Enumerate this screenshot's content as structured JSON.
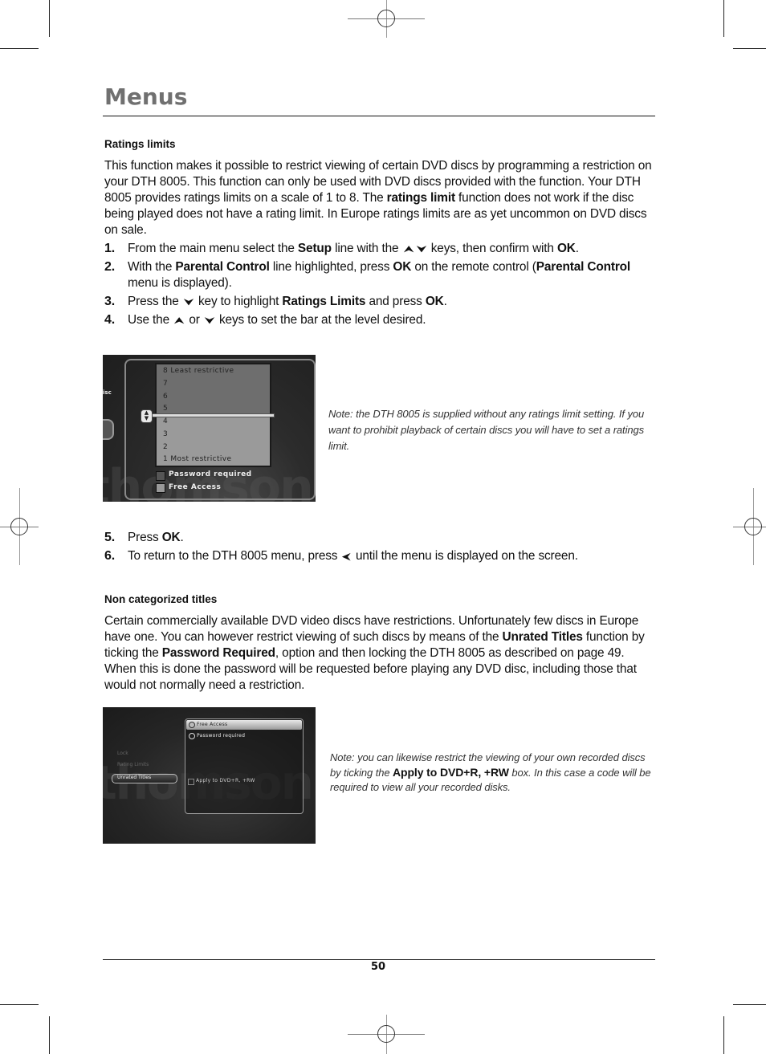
{
  "page": {
    "title": "Menus",
    "page_number": "50"
  },
  "ratings": {
    "heading": "Ratings limits",
    "intro": [
      {
        "t": "This function makes it possible to restrict viewing of certain DVD discs by programming a restriction on your DTH 8005. This function can only be used with DVD discs provided with the function. Your DTH 8005 provides ratings limits on a scale of 1 to 8. The "
      },
      {
        "b": "ratings limit"
      },
      {
        "t": " function does not work if the disc being played does not have a rating limit. In Europe ratings limits are as yet uncommon on DVD discs on sale."
      }
    ],
    "steps": [
      {
        "num": "1.",
        "parts": [
          {
            "t": "From the main menu select the "
          },
          {
            "b": "Setup"
          },
          {
            "t": " line with the "
          },
          {
            "k": "up-arrow"
          },
          {
            "k": "down-arrow"
          },
          {
            "t": " keys, then confirm with "
          },
          {
            "b": "OK"
          },
          {
            "t": "."
          }
        ]
      },
      {
        "num": "2.",
        "parts": [
          {
            "t": "With the "
          },
          {
            "b": "Parental Control"
          },
          {
            "t": " line highlighted, press "
          },
          {
            "b": "OK"
          },
          {
            "t": " on the remote control ("
          },
          {
            "b": "Parental Control"
          },
          {
            "t": " menu is displayed)."
          }
        ]
      },
      {
        "num": "3.",
        "parts": [
          {
            "t": "Press the "
          },
          {
            "k": "down-arrow"
          },
          {
            "t": " key to highlight "
          },
          {
            "b": "Ratings Limits"
          },
          {
            "t": " and press "
          },
          {
            "b": "OK"
          },
          {
            "t": "."
          }
        ]
      },
      {
        "num": "4.",
        "parts": [
          {
            "t": "Use the "
          },
          {
            "k": "up-arrow"
          },
          {
            "t": " or "
          },
          {
            "k": "down-arrow"
          },
          {
            "t": " keys to set the bar at the level desired."
          }
        ]
      }
    ],
    "screen": {
      "side_label": "isc",
      "levels": [
        "8 Least restrictive",
        "7",
        "6",
        "5",
        "4",
        "3",
        "2",
        "1 Most restrictive"
      ],
      "selected_level": 5,
      "checkboxes": [
        "Password required",
        "Free Access"
      ],
      "watermark": "thomson"
    },
    "note": "Note: the DTH 8005 is supplied without any ratings limit setting. If you want to prohibit playback of certain discs you will have to set a ratings limit.",
    "steps2": [
      {
        "num": "5.",
        "parts": [
          {
            "t": "Press "
          },
          {
            "b": "OK"
          },
          {
            "t": "."
          }
        ]
      },
      {
        "num": "6.",
        "parts": [
          {
            "t": "To return to the DTH 8005 menu, press "
          },
          {
            "k": "left-arrow"
          },
          {
            "t": " until the menu is displayed on the screen."
          }
        ]
      }
    ]
  },
  "unrated": {
    "heading": "Non categorized titles",
    "intro": [
      {
        "t": "Certain commercially available DVD video discs have restrictions. Unfortunately few discs in Europe have one. You can however restrict viewing of such discs by means of the "
      },
      {
        "b": "Unrated Titles"
      },
      {
        "t": " function by ticking the "
      },
      {
        "b": "Password Required"
      },
      {
        "t": ", option and then locking the DTH 8005 as described on page 49. When this is done the password will be requested before playing any DVD disc, including those that would not normally need a restriction."
      }
    ],
    "screen": {
      "menu_items": [
        "Lock",
        "Rating Limits",
        "Unrated Titles"
      ],
      "selected_menu": "Unrated Titles",
      "options": [
        "Free Access",
        "Password required"
      ],
      "selected_option": "Free Access",
      "checkbox_label": "Apply to DVD+R, +RW",
      "watermark": "thomson"
    },
    "note": [
      {
        "t": "Note: you can likewise restrict the viewing of your own recorded discs by ticking the "
      },
      {
        "b": "Apply to DVD+R, +RW"
      },
      {
        "t": " box. In this case a  code will be required to view all your recorded disks."
      }
    ]
  },
  "icons": {
    "up-arrow": "⮝",
    "down-arrow": "⮟",
    "left-arrow": "⮜"
  }
}
